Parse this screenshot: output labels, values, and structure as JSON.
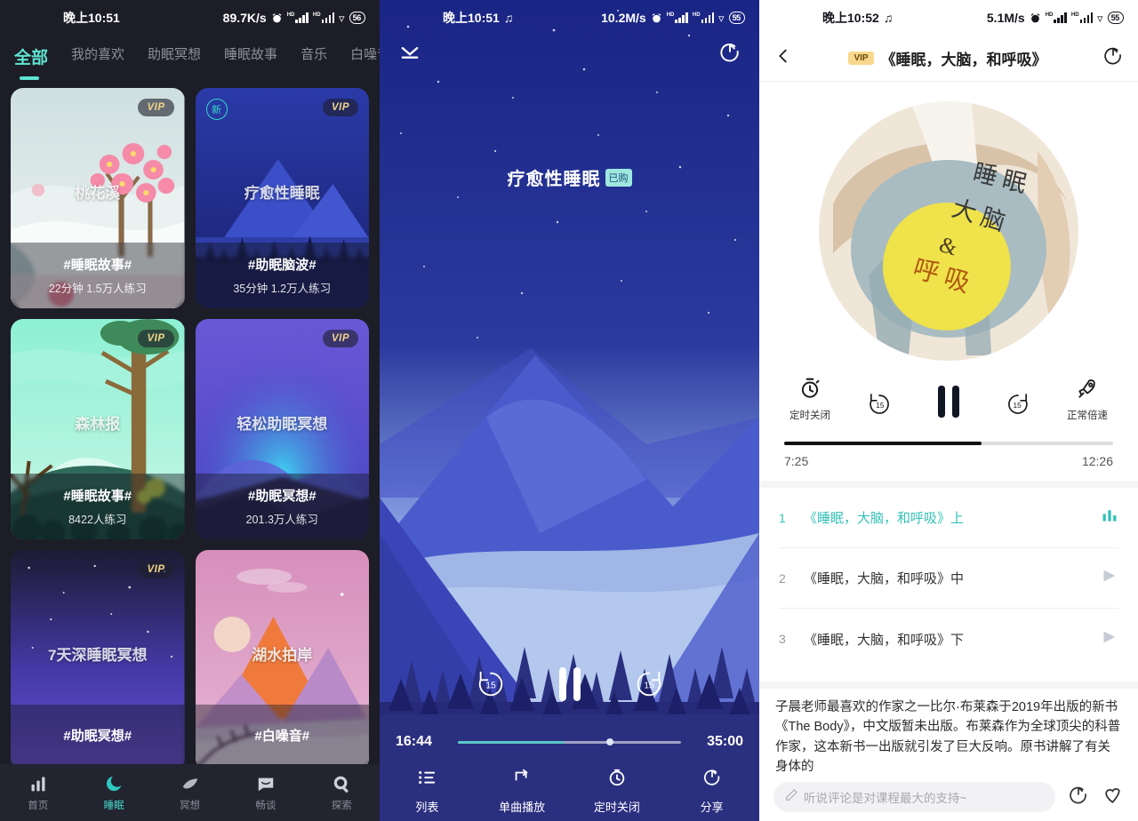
{
  "panel1": {
    "status": {
      "time": "晚上10:51",
      "speed": "89.7K/s",
      "battery": "56"
    },
    "tabs": [
      {
        "label": "全部",
        "active": true
      },
      {
        "label": "我的喜欢",
        "active": false
      },
      {
        "label": "助眠冥想",
        "active": false
      },
      {
        "label": "睡眠故事",
        "active": false
      },
      {
        "label": "音乐",
        "active": false
      },
      {
        "label": "白噪音",
        "active": false
      }
    ],
    "cards": [
      {
        "title": "桃花溪",
        "tag": "#睡眠故事#",
        "sub": "22分钟 1.5万人练习",
        "vip": "VIP",
        "new": ""
      },
      {
        "title": "疗愈性睡眠",
        "tag": "#助眠脑波#",
        "sub": "35分钟 1.2万人练习",
        "vip": "VIP",
        "new": "新"
      },
      {
        "title": "森林报",
        "tag": "#睡眠故事#",
        "sub": "8422人练习",
        "vip": "VIP",
        "new": ""
      },
      {
        "title": "轻松助眠冥想",
        "tag": "#助眠冥想#",
        "sub": "201.3万人练习",
        "vip": "VIP",
        "new": ""
      },
      {
        "title": "7天深睡眠冥想",
        "tag": "#助眠冥想#",
        "sub": "",
        "vip": "VIP",
        "new": ""
      },
      {
        "title": "湖水拍岸",
        "tag": "#白噪音#",
        "sub": "",
        "vip": "",
        "new": ""
      }
    ],
    "nav": [
      {
        "label": "首页",
        "icon": "bar-chart-icon",
        "active": false
      },
      {
        "label": "睡眠",
        "icon": "moon-icon",
        "active": true
      },
      {
        "label": "冥想",
        "icon": "leaf-icon",
        "active": false
      },
      {
        "label": "畅谈",
        "icon": "chat-icon",
        "active": false
      },
      {
        "label": "探索",
        "icon": "search-icon",
        "active": false
      }
    ]
  },
  "panel2": {
    "status": {
      "time": "晚上10:51",
      "speed": "10.2M/s",
      "battery": "55"
    },
    "title": "疗愈性睡眠",
    "badge": "已购",
    "elapsed": "16:44",
    "duration": "35:00",
    "progress_percent": 48,
    "rewind_label": "15",
    "forward_label": "15",
    "actions": [
      {
        "label": "列表",
        "icon": "list-icon"
      },
      {
        "label": "单曲播放",
        "icon": "repeat-one-icon"
      },
      {
        "label": "定时关闭",
        "icon": "timer-icon"
      },
      {
        "label": "分享",
        "icon": "share-icon"
      }
    ]
  },
  "panel3": {
    "status": {
      "time": "晚上10:52",
      "speed": "5.1M/s",
      "battery": "55"
    },
    "vip": "VIP",
    "title": "《睡眠，大脑，和呼吸》",
    "cover": {
      "line1": "睡 眠",
      "line2": "大 脑",
      "amp": "&",
      "line3": "呼 吸"
    },
    "controls": [
      {
        "label": "定时关闭",
        "icon": "timer-icon"
      },
      {
        "label": "",
        "icon": "rewind-15-icon",
        "value": "15"
      },
      {
        "label": "",
        "icon": "pause-icon"
      },
      {
        "label": "",
        "icon": "forward-15-icon",
        "value": "15"
      },
      {
        "label": "正常倍速",
        "icon": "rocket-icon"
      }
    ],
    "elapsed": "7:25",
    "duration": "12:26",
    "progress_percent": 60,
    "chapters": [
      {
        "index": "1",
        "name": "《睡眠，大脑，和呼吸》上",
        "active": true,
        "icon": "equalizer-icon"
      },
      {
        "index": "2",
        "name": "《睡眠，大脑，和呼吸》中",
        "active": false,
        "icon": "play-icon"
      },
      {
        "index": "3",
        "name": "《睡眠，大脑，和呼吸》下",
        "active": false,
        "icon": "play-icon"
      }
    ],
    "description": "子晨老师最喜欢的作家之一比尔·布莱森于2019年出版的新书《The Body》，中文版暂未出版。布莱森作为全球顶尖的科普作家，这本新书一出版就引发了巨大反响。原书讲解了有关身体的",
    "comment_placeholder": "听说评论是对课程最大的支持~"
  },
  "colors": {
    "accent_teal": "#46d9cb",
    "vip_gold": "#f0d48a",
    "panel1_bg": "#1c1d26",
    "panel3_active": "#34c2b8"
  }
}
